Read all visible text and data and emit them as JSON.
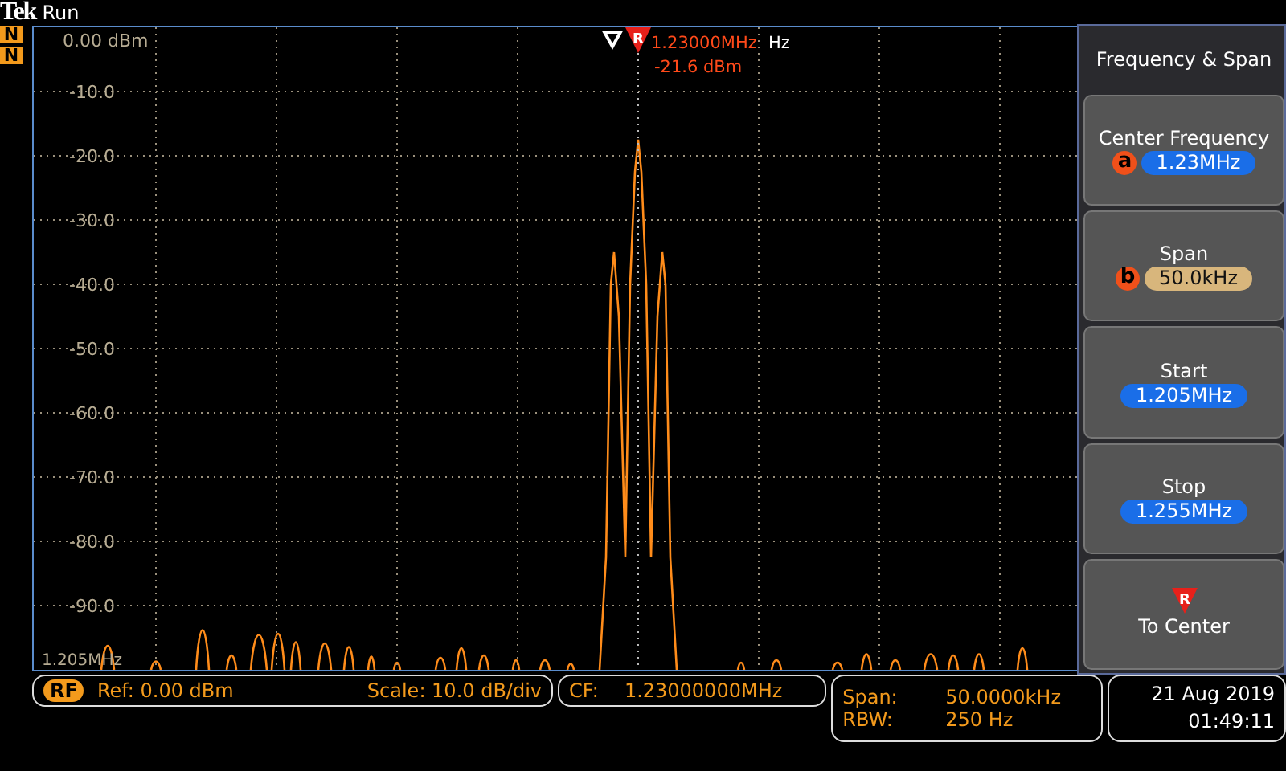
{
  "top_bar": {
    "logo": "Tek",
    "status": "Run"
  },
  "indicators": [
    "N",
    "N"
  ],
  "display": {
    "y_labels": [
      "0.00 dBm",
      "-10.0",
      "-20.0",
      "-30.0",
      "-40.0",
      "-50.0",
      "-60.0",
      "-70.0",
      "-80.0",
      "-90.0"
    ],
    "x_start_label": "1.205MHz",
    "marker": {
      "label": "R",
      "frequency": "1.23000MHz",
      "frequency_tail": "Hz",
      "amplitude": "-21.6 dBm"
    }
  },
  "menu": {
    "title": "Frequency & Span",
    "items": [
      {
        "kind": "value",
        "label": "Center Frequency",
        "knob": "a",
        "value": "1.23MHz",
        "color": "#1a6ee8"
      },
      {
        "kind": "value",
        "label": "Span",
        "knob": "b",
        "value": "50.0kHz",
        "color": "#d8b67c"
      },
      {
        "kind": "value",
        "label": "Start",
        "value": "1.205MHz",
        "color": "#1a6ee8"
      },
      {
        "kind": "value",
        "label": "Stop",
        "value": "1.255MHz",
        "color": "#1a6ee8"
      },
      {
        "kind": "action",
        "label": "To Center",
        "icon_label": "R"
      }
    ]
  },
  "status": {
    "source": "RF",
    "ref": "Ref: 0.00 dBm",
    "scale": "Scale: 10.0 dB/div",
    "cf_label": "CF:",
    "cf_value": "1.23000000MHz",
    "span_label": "Span:",
    "span_value": "50.0000kHz",
    "rbw_label": "RBW:",
    "rbw_value": "250 Hz",
    "date": "21 Aug 2019",
    "time": "01:49:11"
  }
}
